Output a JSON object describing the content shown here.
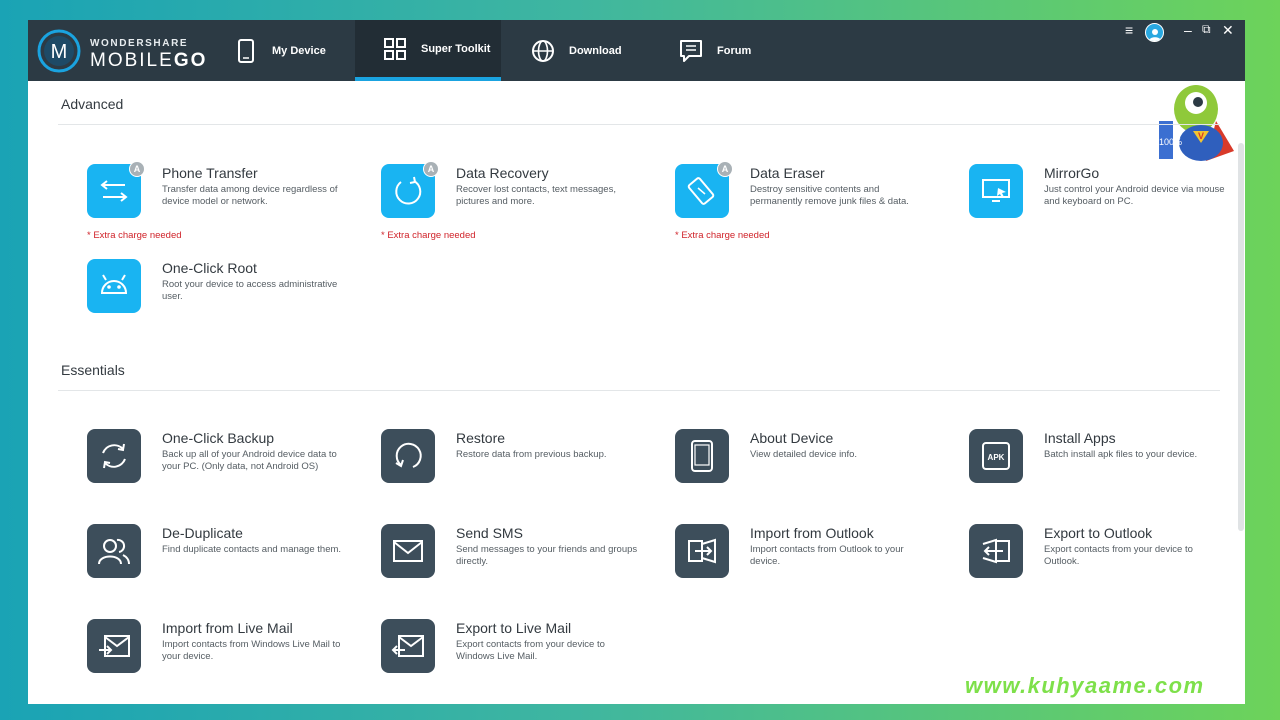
{
  "app": {
    "brand": "WONDERSHARE",
    "product_light": "MOBILE",
    "product_bold": "GO",
    "logo_letter": "M"
  },
  "nav": {
    "tabs": [
      {
        "label": "My Device",
        "icon": "phone-icon",
        "active": false
      },
      {
        "label": "Super Toolkit",
        "icon": "grid-icon",
        "active": true
      },
      {
        "label": "Download",
        "icon": "globe-icon",
        "active": false
      },
      {
        "label": "Forum",
        "icon": "forum-icon",
        "active": false
      }
    ]
  },
  "window_controls": {
    "menu": "≡",
    "minimize": "–",
    "restore": "⧉",
    "close": "✕"
  },
  "sections": {
    "advanced": {
      "title": "Advanced",
      "items": [
        {
          "title": "Phone Transfer",
          "desc": "Transfer data among device regardless of device model or network.",
          "note": "* Extra charge needed",
          "badge": "A",
          "icon": "transfer-icon"
        },
        {
          "title": "Data Recovery",
          "desc": "Recover lost contacts, text messages, pictures and more.",
          "note": "* Extra charge needed",
          "badge": "A",
          "icon": "recovery-icon"
        },
        {
          "title": "Data Eraser",
          "desc": "Destroy sensitive contents and permanently remove junk files & data.",
          "note": "* Extra charge needed",
          "badge": "A",
          "icon": "eraser-icon"
        },
        {
          "title": "MirrorGo",
          "desc": "Just control your Android device via mouse and keyboard on PC.",
          "icon": "monitor-icon"
        },
        {
          "title": "One-Click Root",
          "desc": "Root your device to access administrative user.",
          "icon": "android-icon"
        }
      ]
    },
    "essentials": {
      "title": "Essentials",
      "items": [
        {
          "title": "One-Click Backup",
          "desc": "Back up all of your Android device data to your PC. (Only data, not Android OS)",
          "icon": "backup-icon"
        },
        {
          "title": "Restore",
          "desc": "Restore data from previous backup.",
          "icon": "restore-icon"
        },
        {
          "title": "About Device",
          "desc": "View detailed device info.",
          "icon": "device-icon"
        },
        {
          "title": "Install Apps",
          "desc": "Batch install apk files to your device.",
          "icon": "apk-icon",
          "icon_text": "APK"
        },
        {
          "title": "De-Duplicate",
          "desc": "Find duplicate contacts and manage them.",
          "icon": "contacts-icon"
        },
        {
          "title": "Send SMS",
          "desc": "Send messages to your friends and groups directly.",
          "icon": "envelope-icon"
        },
        {
          "title": "Import from Outlook",
          "desc": "Import contacts from Outlook to your device.",
          "icon": "outlook-import-icon"
        },
        {
          "title": "Export to Outlook",
          "desc": "Export contacts from your device to Outlook.",
          "icon": "outlook-export-icon"
        },
        {
          "title": "Import from Live Mail",
          "desc": "Import contacts from Windows Live Mail to your device.",
          "icon": "livemail-import-icon"
        },
        {
          "title": "Export to Live Mail",
          "desc": "Export contacts from your device to Windows Live Mail.",
          "icon": "livemail-export-icon"
        }
      ]
    }
  },
  "mascot": {
    "percent": "100%",
    "emblem": "V"
  },
  "watermark": "www.kuhyaame.com",
  "colors": {
    "topbar": "#2c3a44",
    "active_tab_underline": "#1aa3e0",
    "advanced_tile": "#19b4f2",
    "essentials_tile": "#3d4e5b",
    "extra_charge_note": "#d0232a"
  }
}
